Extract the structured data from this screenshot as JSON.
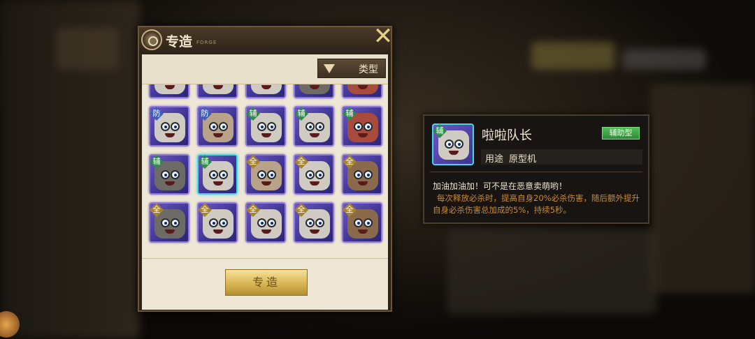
{
  "forge_panel": {
    "title": "专造",
    "subtitle": "FORGE",
    "close_icon": "close-icon",
    "filter": {
      "label": "类型",
      "icon": "triangle-down-icon"
    },
    "cards": [
      {
        "badge": "防",
        "face": "c1"
      },
      {
        "badge": "防",
        "face": "c2"
      },
      {
        "badge": "辅",
        "face": "c1"
      },
      {
        "badge": "辅",
        "face": "c1"
      },
      {
        "badge": "辅",
        "face": "c3"
      },
      {
        "badge": "辅",
        "face": "c4"
      },
      {
        "badge": "辅",
        "face": "c1",
        "selected": true
      },
      {
        "badge": "全",
        "face": "c2"
      },
      {
        "badge": "全",
        "face": "c1"
      },
      {
        "badge": "全",
        "face": "c5"
      },
      {
        "badge": "全",
        "face": "c4"
      },
      {
        "badge": "全",
        "face": "c1"
      },
      {
        "badge": "全",
        "face": "c1"
      },
      {
        "badge": "全",
        "face": "c1"
      },
      {
        "badge": "全",
        "face": "c5"
      }
    ],
    "forge_button": "专造"
  },
  "detail_panel": {
    "portrait_badge": "辅",
    "name": "啦啦队长",
    "role": "辅助型",
    "usage_label": "用途",
    "usage_value": "原型机",
    "quote": "加油加油加！可不是在恶意卖萌哟！",
    "effect": "每次释放必杀时，提高自身20%必杀伤害，随后额外提升自身必杀伤害总加成的5%，持续5秒。"
  }
}
